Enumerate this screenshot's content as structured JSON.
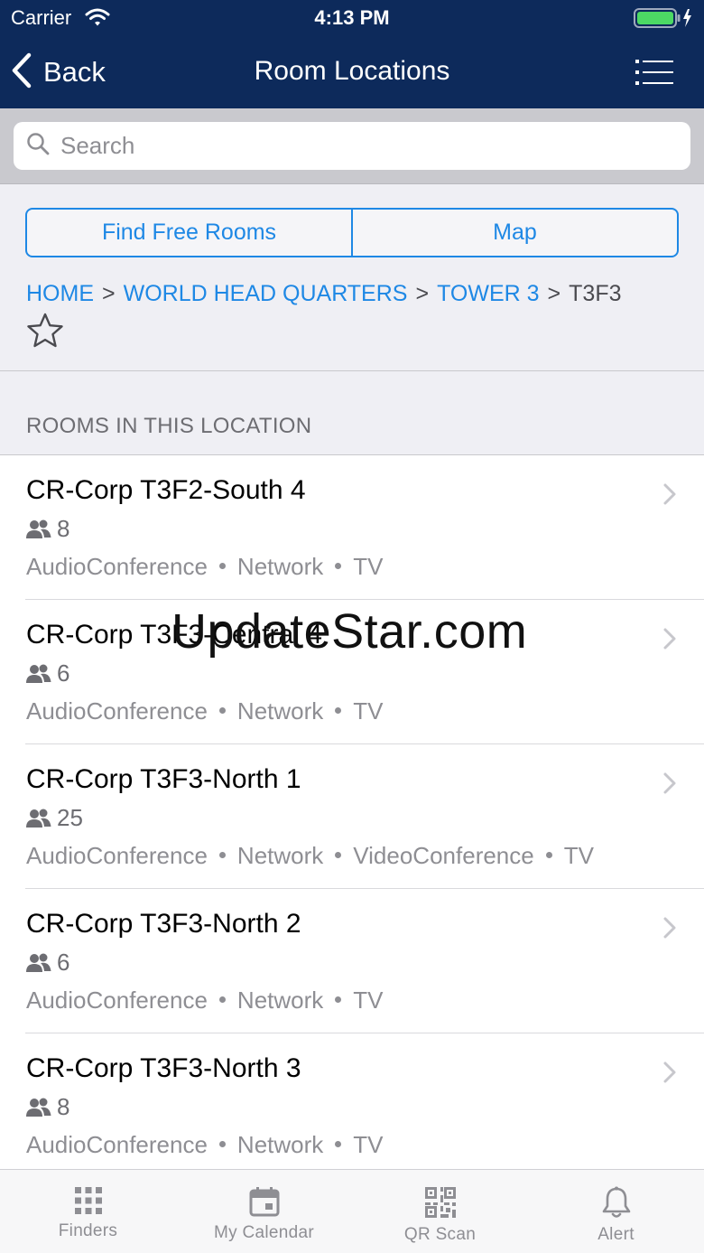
{
  "status_bar": {
    "carrier": "Carrier",
    "time": "4:13 PM"
  },
  "nav": {
    "back_label": "Back",
    "title": "Room Locations"
  },
  "search": {
    "placeholder": "Search",
    "value": ""
  },
  "segment": {
    "find_free_rooms": "Find Free Rooms",
    "map": "Map"
  },
  "breadcrumb": {
    "items": [
      "HOME",
      "WORLD HEAD QUARTERS",
      "TOWER 3",
      "T3F3"
    ],
    "separator": ">"
  },
  "section_header": "ROOMS IN THIS LOCATION",
  "rooms": [
    {
      "name": "CR-Corp T3F2-South 4",
      "capacity": "8",
      "amenities": [
        "AudioConference",
        "Network",
        "TV"
      ]
    },
    {
      "name": "CR-Corp T3F3-Central 4",
      "capacity": "6",
      "amenities": [
        "AudioConference",
        "Network",
        "TV"
      ]
    },
    {
      "name": "CR-Corp T3F3-North 1",
      "capacity": "25",
      "amenities": [
        "AudioConference",
        "Network",
        "VideoConference",
        "TV"
      ]
    },
    {
      "name": "CR-Corp T3F3-North 2",
      "capacity": "6",
      "amenities": [
        "AudioConference",
        "Network",
        "TV"
      ]
    },
    {
      "name": "CR-Corp T3F3-North 3",
      "capacity": "8",
      "amenities": [
        "AudioConference",
        "Network",
        "TV"
      ]
    }
  ],
  "watermark": "UpdateStar.com",
  "tabs": [
    {
      "label": "Finders",
      "icon": "grid-icon"
    },
    {
      "label": "My Calendar",
      "icon": "calendar-icon"
    },
    {
      "label": "QR Scan",
      "icon": "qr-code-icon"
    },
    {
      "label": "Alert",
      "icon": "bell-icon"
    }
  ],
  "colors": {
    "nav_bg": "#0d2a5b",
    "accent": "#1e88e5",
    "battery": "#4cd964"
  }
}
